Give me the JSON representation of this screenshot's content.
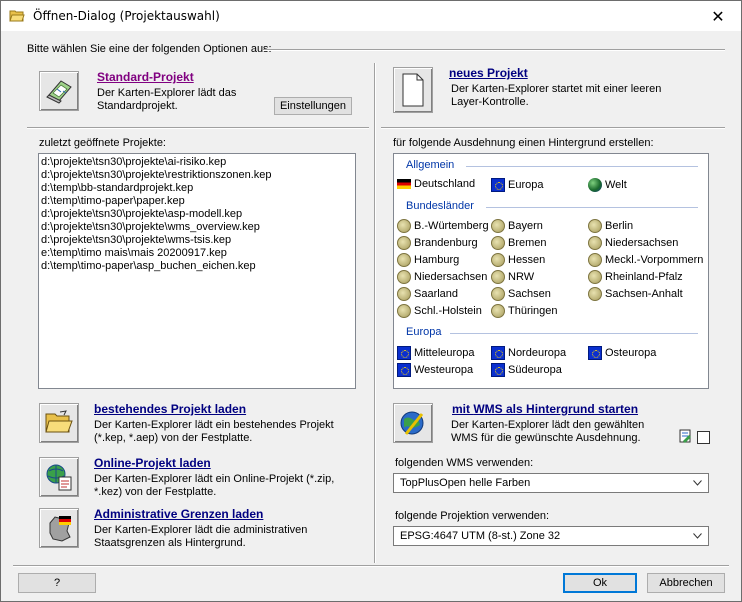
{
  "window": {
    "title": "Öffnen-Dialog (Projektauswahl)",
    "close_glyph": "✕"
  },
  "header": {
    "prompt": "Bitte wählen Sie eine der folgenden Optionen aus:"
  },
  "standard_project": {
    "title_rest": "tandard-Projekt",
    "title_accel": "S",
    "description": "Der Karten-Explorer lädt das Standardprojekt.",
    "settings_label": "Einstellungen",
    "icon": "map-scroll-icon"
  },
  "new_project": {
    "title_accel": "n",
    "title_rest": "eues Projekt",
    "description": "Der Karten-Explorer startet mit einer leeren Layer-Kontrolle.",
    "icon": "blank-document-icon"
  },
  "recent": {
    "label": "zuletzt geöffnete Projekte:",
    "items": [
      "d:\\projekte\\tsn30\\projekte\\ai-risiko.kep",
      "d:\\projekte\\tsn30\\projekte\\restriktionszonen.kep",
      "d:\\temp\\bb-standardprojekt.kep",
      "d:\\temp\\timo-paper\\paper.kep",
      "d:\\projekte\\tsn30\\projekte\\asp-modell.kep",
      "d:\\projekte\\tsn30\\projekte\\wms_overview.kep",
      "d:\\projekte\\tsn30\\projekte\\wms-tsis.kep",
      "e:\\temp\\timo mais\\mais 20200917.kep",
      "d:\\temp\\timo-paper\\asp_buchen_eichen.kep"
    ]
  },
  "background": {
    "label": "für folgende Ausdehnung einen Hintergrund erstellen:",
    "sections": {
      "allgemein": "Allgemein",
      "bundeslaender": "Bundesländer",
      "europa": "Europa"
    },
    "allgemein": [
      "Deutschland",
      "Europa",
      "Welt"
    ],
    "states_col1": [
      "B.-Würtemberg",
      "Brandenburg",
      "Hamburg",
      "Niedersachsen",
      "Saarland",
      "Schl.-Holstein"
    ],
    "states_col2": [
      "Bayern",
      "Bremen",
      "Hessen",
      "NRW",
      "Sachsen",
      "Thüringen"
    ],
    "states_col3": [
      "Berlin",
      "Niedersachsen",
      "Meckl.-Vorpommern",
      "Rheinland-Pfalz",
      "Sachsen-Anhalt"
    ],
    "europa_col1": [
      "Mitteleuropa",
      "Westeuropa"
    ],
    "europa_col2": [
      "Nordeuropa",
      "Südeuropa"
    ],
    "europa_col3": [
      "Osteuropa"
    ]
  },
  "load_project": {
    "title_accel": "b",
    "title_rest": "estehendes Projekt laden",
    "description": "Der Karten-Explorer lädt ein bestehendes Projekt (*.kep, *.aep)  von der Festplatte.",
    "icon": "open-folder-icon"
  },
  "online_project": {
    "title_accel": "O",
    "title_rest": "nline-Projekt laden",
    "description": "Der Karten-Explorer lädt ein Online-Projekt (*.zip, *.kez) von der Festplatte.",
    "icon": "globe-document-icon"
  },
  "admin_borders": {
    "title_accel": "A",
    "title_rest": "dministrative Grenzen laden",
    "description": "Der Karten-Explorer lädt die administrativen Staatsgrenzen als Hintergrund.",
    "icon": "germany-map-icon"
  },
  "wms_start": {
    "title_pre": "mit ",
    "title_accel": "W",
    "title_rest": "MS als Hintergrund starten",
    "description": "Der Karten-Explorer lädt den gewählten WMS für die gewünschte Ausdehnung.",
    "icon": "globe-pen-icon"
  },
  "wms_select": {
    "label": "folgenden WMS verwenden:",
    "value": "TopPlusOpen helle Farben"
  },
  "projection_select": {
    "label": "folgende Projektion verwenden:",
    "value": "EPSG:4647 UTM (8-st.) Zone 32"
  },
  "footer": {
    "help_label": "?",
    "ok_label": "Ok",
    "cancel_label": "Abbrechen"
  }
}
